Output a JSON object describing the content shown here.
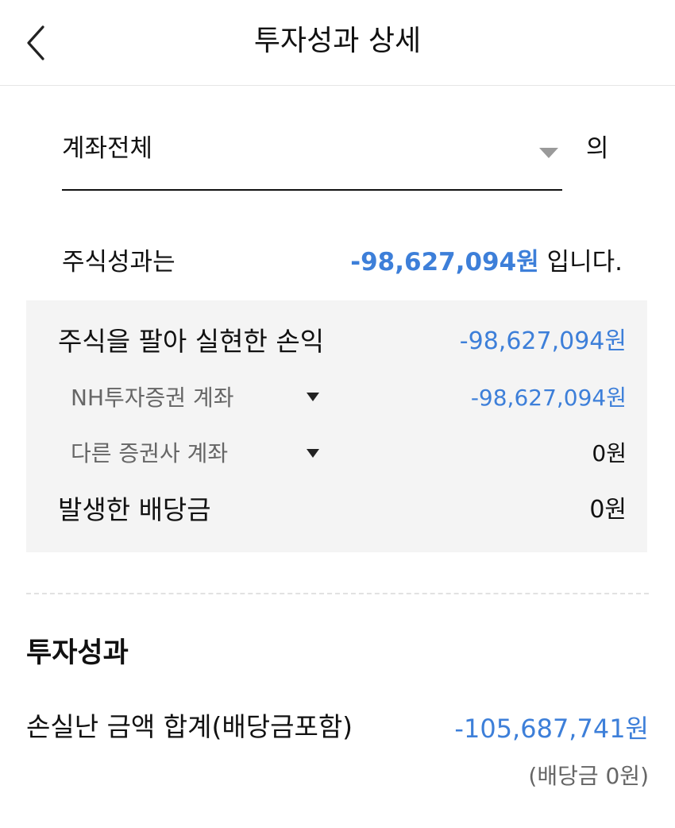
{
  "header": {
    "title": "투자성과 상세"
  },
  "account_select": {
    "value": "계좌전체",
    "suffix": "의"
  },
  "summary": {
    "label": "주식성과는",
    "amount": "-98,627,094원",
    "suffix": "입니다."
  },
  "detail": {
    "realized": {
      "label": "주식을 팔아 실현한 손익",
      "value": "-98,627,094원"
    },
    "nh_account": {
      "label": "NH투자증권 계좌",
      "value": "-98,627,094원"
    },
    "other_account": {
      "label": "다른 증권사 계좌",
      "value": "0원"
    },
    "dividend": {
      "label": "발생한 배당금",
      "value": "0원"
    }
  },
  "performance": {
    "title": "투자성과",
    "total_label": "손실난 금액 합계(배당금포함)",
    "total_value": "-105,687,741원",
    "dividend_note": "(배당금 0원)"
  },
  "icons": {
    "back": "chevron-left-icon",
    "dropdown": "caret-down-icon",
    "expand": "triangle-down-icon"
  },
  "colors": {
    "accent": "#3d7fd9",
    "panel": "#f4f4f4"
  }
}
